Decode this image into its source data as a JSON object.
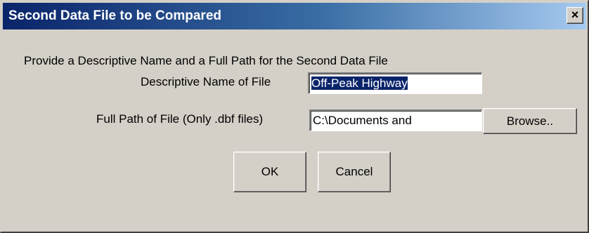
{
  "window": {
    "title": "Second Data File to be Compared",
    "close_glyph": "×"
  },
  "instructions": "Provide a Descriptive Name and a Full Path for the Second Data File",
  "name_field": {
    "label": "Descriptive Name of File",
    "value": "Off-Peak Highway"
  },
  "path_field": {
    "label": "Full Path of File (Only .dbf files)",
    "value": "C:\\Documents and"
  },
  "buttons": {
    "browse": "Browse..",
    "ok": "OK",
    "cancel": "Cancel"
  },
  "colors": {
    "title_gradient_start": "#0a246a",
    "title_gradient_end": "#a6caf0",
    "dialog_face": "#d4d0c8",
    "selection": "#0a246a"
  },
  "icons": {
    "close": "close-icon"
  }
}
